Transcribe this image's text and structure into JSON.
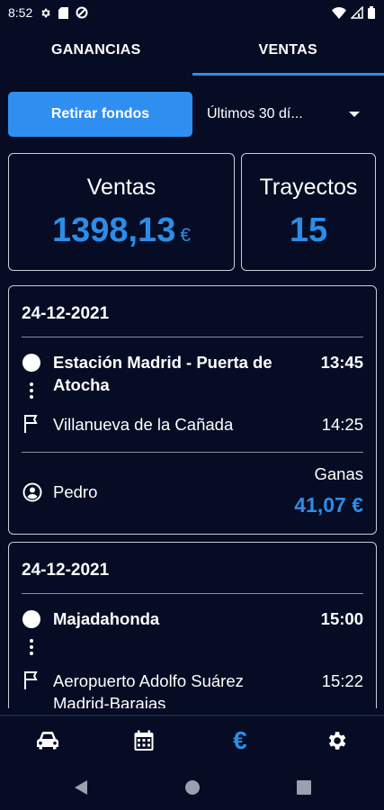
{
  "status_bar": {
    "time": "8:52",
    "left_icons": [
      "settings-icon",
      "sim-card-icon",
      "blocked-icon"
    ],
    "right_icons": [
      "wifi-icon",
      "signal-icon",
      "battery-icon"
    ]
  },
  "tabs": [
    {
      "label": "GANANCIAS",
      "active": false
    },
    {
      "label": "VENTAS",
      "active": true
    }
  ],
  "controls": {
    "withdraw_label": "Retirar fondos",
    "period_value": "Últimos 30 dí..."
  },
  "stats": {
    "sales_title": "Ventas",
    "sales_value": "1398,13",
    "sales_unit": "€",
    "trips_title": "Trayectos",
    "trips_value": "15"
  },
  "trips": [
    {
      "date": "24-12-2021",
      "origin": "Estación Madrid - Puerta de Atocha",
      "origin_time": "13:45",
      "destination": "Villanueva de la Cañada",
      "destination_time": "14:25",
      "driver": "Pedro",
      "earn_label": "Ganas",
      "earn_value": "41,07 €"
    },
    {
      "date": "24-12-2021",
      "origin": "Majadahonda",
      "origin_time": "15:00",
      "destination": "Aeropuerto Adolfo Suárez Madrid-Barajas",
      "destination_time": "15:22"
    }
  ],
  "bottom_nav": [
    {
      "icon": "car-icon",
      "active": false
    },
    {
      "icon": "calendar-icon",
      "active": false
    },
    {
      "icon": "euro-icon",
      "label": "€",
      "active": true
    },
    {
      "icon": "gear-icon",
      "active": false
    }
  ],
  "system_nav": [
    "back-icon",
    "home-icon",
    "recents-icon"
  ],
  "colors": {
    "background": "#050c24",
    "accent": "#2b8de8",
    "button": "#2f8ff0",
    "card_border": "#c9cdd6"
  }
}
